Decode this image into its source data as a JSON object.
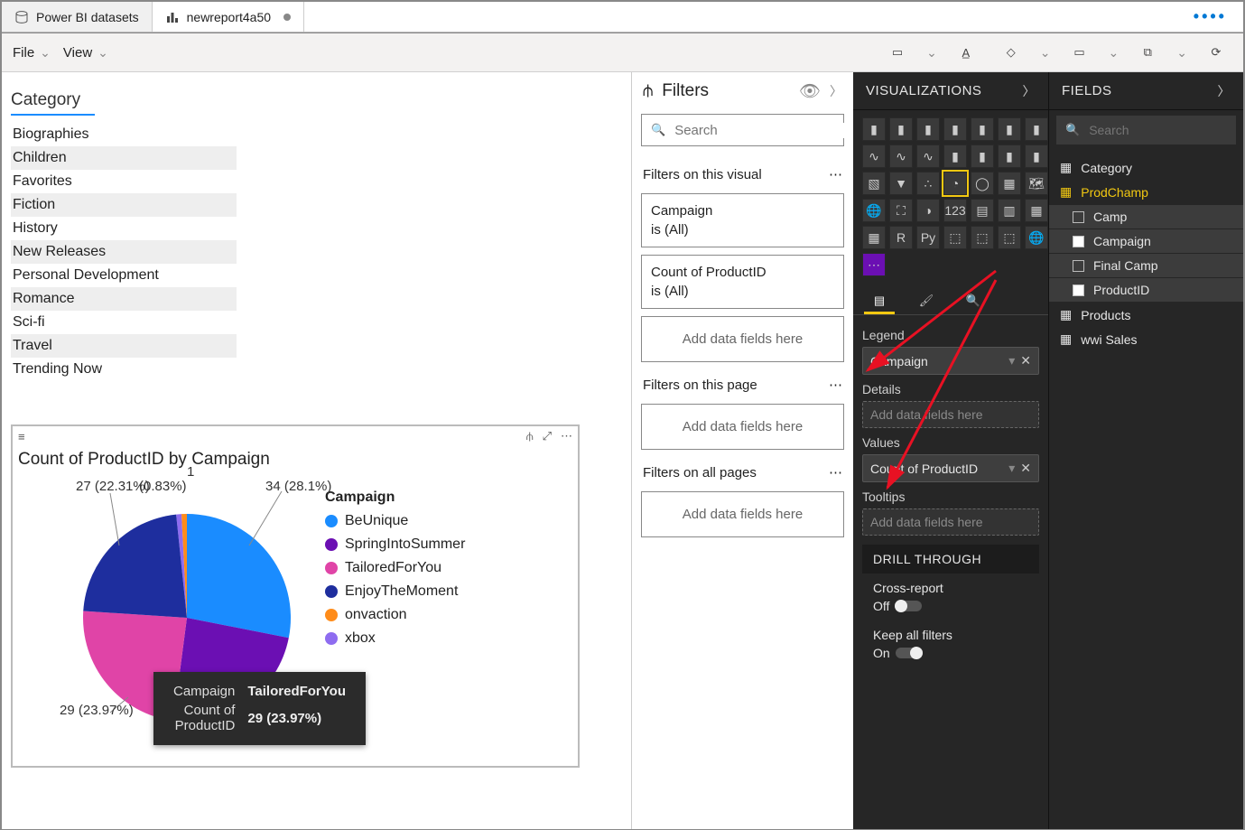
{
  "tabs": [
    {
      "label": "Power BI datasets",
      "icon": "database"
    },
    {
      "label": "newreport4a50",
      "icon": "barchart",
      "active": true,
      "dirty": true
    }
  ],
  "overflow": "••••",
  "menus": {
    "file": "File",
    "view": "View"
  },
  "slicer": {
    "title": "Category",
    "items": [
      "Biographies",
      "Children",
      "Favorites",
      "Fiction",
      "History",
      "New Releases",
      "Personal Development",
      "Romance",
      "Sci-fi",
      "Travel",
      "Trending Now"
    ]
  },
  "pie": {
    "title": "Count of ProductID by Campaign",
    "legendTitle": "Campaign",
    "labels": {
      "outlier": "1",
      "outlierPct": "(0.83%)",
      "a": "34 (28.1%)",
      "b": "29 (23.97%)",
      "c": "29 (23.97%)",
      "d": "27 (22.31%)"
    },
    "tooltip": {
      "kCampaign": "Campaign",
      "vCampaign": "TailoredForYou",
      "kCount": "Count of ProductID",
      "vCount": "29 (23.97%)"
    }
  },
  "chart_data": {
    "type": "pie",
    "title": "Count of ProductID by Campaign",
    "series": [
      {
        "name": "BeUnique",
        "value": 34,
        "pct": 28.1,
        "color": "#1a8cff"
      },
      {
        "name": "SpringIntoSummer",
        "value": 29,
        "pct": 23.97,
        "color": "#6b0fb3"
      },
      {
        "name": "TailoredForYou",
        "value": 29,
        "pct": 23.97,
        "color": "#e044a7"
      },
      {
        "name": "EnjoyTheMoment",
        "value": 27,
        "pct": 22.31,
        "color": "#1e2e9e"
      },
      {
        "name": "onvaction",
        "value": 1,
        "pct": 0.83,
        "color": "#ff8c1a"
      },
      {
        "name": "xbox",
        "value": 1,
        "pct": 0.83,
        "color": "#8e6cf0"
      }
    ]
  },
  "filters": {
    "header": "Filters",
    "searchPlaceholder": "Search",
    "visual": {
      "title": "Filters on this visual",
      "cards": [
        {
          "line1": "Campaign",
          "line2": "is (All)"
        },
        {
          "line1": "Count of ProductID",
          "line2": "is (All)"
        }
      ],
      "placeholder": "Add data fields here"
    },
    "page": {
      "title": "Filters on this page",
      "placeholder": "Add data fields here"
    },
    "all": {
      "title": "Filters on all pages",
      "placeholder": "Add data fields here"
    }
  },
  "viz": {
    "header": "VISUALIZATIONS",
    "wells": {
      "legend": {
        "label": "Legend",
        "value": "Campaign"
      },
      "details": {
        "label": "Details",
        "placeholder": "Add data fields here"
      },
      "values": {
        "label": "Values",
        "value": "Count of ProductID"
      },
      "tooltips": {
        "label": "Tooltips",
        "placeholder": "Add data fields here"
      }
    },
    "drill": {
      "header": "DRILL THROUGH",
      "cross": {
        "label": "Cross-report",
        "state": "Off"
      },
      "keep": {
        "label": "Keep all filters",
        "state": "On"
      }
    }
  },
  "fields": {
    "header": "FIELDS",
    "searchPlaceholder": "Search",
    "tables": [
      {
        "name": "Category",
        "expanded": false
      },
      {
        "name": "ProdChamp",
        "expanded": true,
        "highlight": true,
        "fields": [
          {
            "name": "Camp",
            "checked": false
          },
          {
            "name": "Campaign",
            "checked": true
          },
          {
            "name": "Final Camp",
            "checked": false
          },
          {
            "name": "ProductID",
            "checked": true
          }
        ]
      },
      {
        "name": "Products",
        "expanded": false
      },
      {
        "name": "wwi Sales",
        "expanded": false
      }
    ]
  }
}
